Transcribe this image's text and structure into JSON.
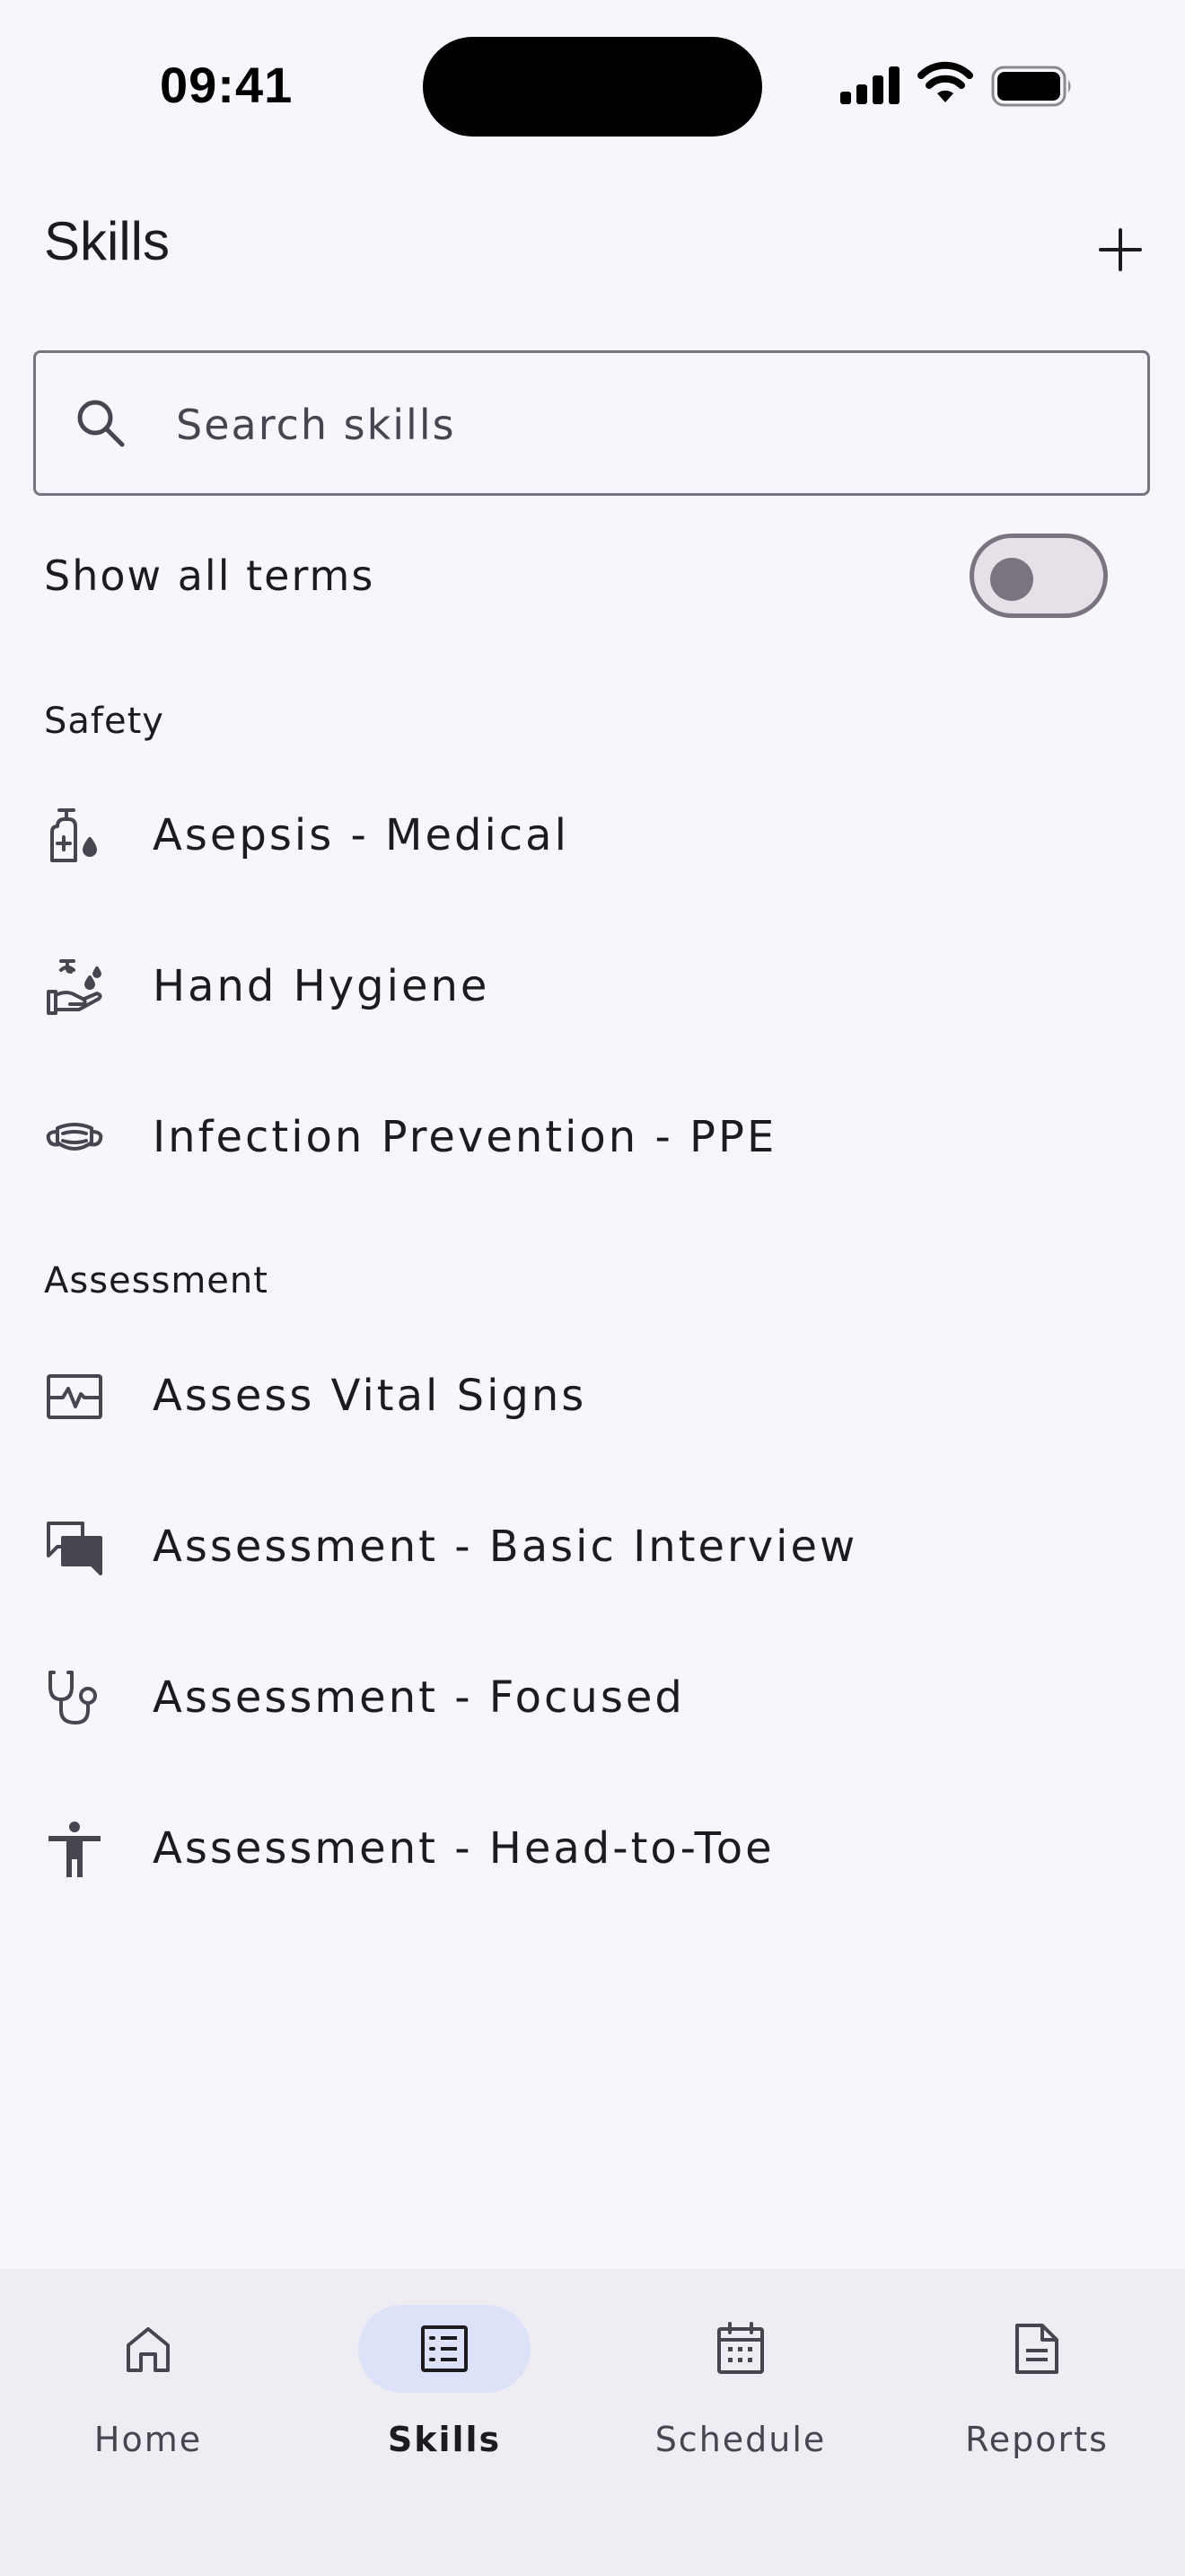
{
  "status_bar": {
    "time": "09:41"
  },
  "header": {
    "title": "Skills",
    "add_icon": "plus-icon"
  },
  "search": {
    "placeholder": "Search skills",
    "value": ""
  },
  "toggle": {
    "label": "Show all terms",
    "on": false
  },
  "sections": [
    {
      "title": "Safety",
      "items": [
        {
          "label": "Asepsis - Medical",
          "icon": "sanitizer-icon"
        },
        {
          "label": "Hand Hygiene",
          "icon": "hand-wash-icon"
        },
        {
          "label": "Infection Prevention - PPE",
          "icon": "mask-icon"
        }
      ]
    },
    {
      "title": "Assessment",
      "items": [
        {
          "label": "Assess Vital Signs",
          "icon": "vital-signs-icon"
        },
        {
          "label": "Assessment - Basic Interview",
          "icon": "chat-bubbles-icon"
        },
        {
          "label": "Assessment - Focused",
          "icon": "stethoscope-icon"
        },
        {
          "label": "Assessment - Head-to-Toe",
          "icon": "person-icon"
        }
      ]
    }
  ],
  "bottom_nav": [
    {
      "label": "Home",
      "icon": "home-icon",
      "active": false
    },
    {
      "label": "Skills",
      "icon": "list-icon",
      "active": true
    },
    {
      "label": "Schedule",
      "icon": "calendar-icon",
      "active": false
    },
    {
      "label": "Reports",
      "icon": "document-icon",
      "active": false
    }
  ],
  "colors": {
    "background": "#f7f6fc",
    "nav_background": "#eeedf4",
    "active_pill": "#dde2f9",
    "outline": "#79747e"
  }
}
